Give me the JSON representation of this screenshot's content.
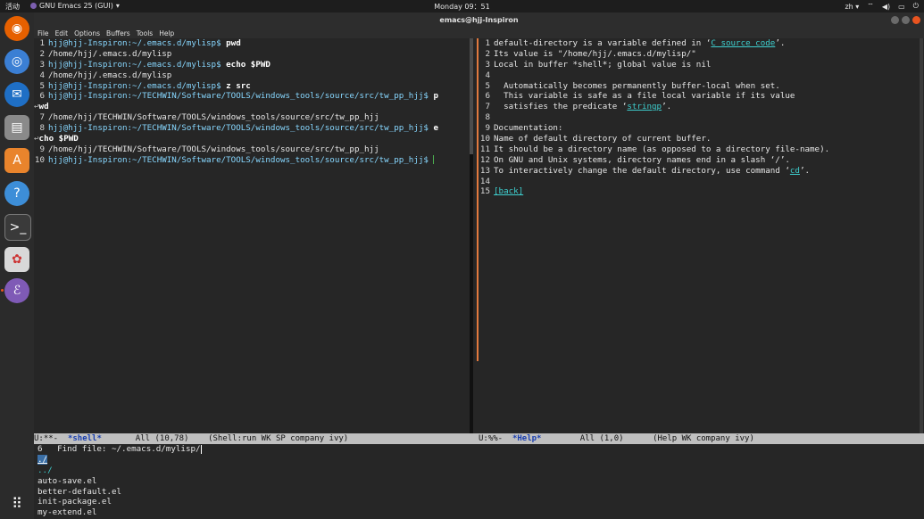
{
  "topbar": {
    "activities": "活动",
    "app_menu": "GNU Emacs 25 (GUI)",
    "clock": "Monday 09：51",
    "lang": "zh"
  },
  "window": {
    "title": "emacs@hjj-Inspiron",
    "menu": [
      "File",
      "Edit",
      "Options",
      "Buffers",
      "Tools",
      "Help"
    ]
  },
  "dock": {
    "apps": [
      "firefox-icon",
      "chromium-icon",
      "thunderbird-icon",
      "files-icon",
      "software-center-icon",
      "help-icon",
      "terminal-icon",
      "paint-icon",
      "emacs-icon"
    ],
    "show_apps": "show-apps-icon"
  },
  "shell": {
    "lines": [
      {
        "n": "1",
        "prompt": "hjj@hjj-Inspiron:~/.emacs.d/mylisp$",
        "cmd": " pwd"
      },
      {
        "n": "2",
        "text": "/home/hjj/.emacs.d/mylisp"
      },
      {
        "n": "3",
        "prompt": "hjj@hjj-Inspiron:~/.emacs.d/mylisp$",
        "cmd": " echo $PWD"
      },
      {
        "n": "4",
        "text": "/home/hjj/.emacs.d/mylisp"
      },
      {
        "n": "5",
        "prompt": "hjj@hjj-Inspiron:~/.emacs.d/mylisp$",
        "cmd": " z src"
      },
      {
        "n": "6",
        "prompt": "hjj@hjj-Inspiron:~/TECHWIN/Software/TOOLS/windows_tools/source/src/tw_pp_hjj$",
        "cmd": " p",
        "cont": "wd"
      },
      {
        "n": "7",
        "text": "/home/hjj/TECHWIN/Software/TOOLS/windows_tools/source/src/tw_pp_hjj"
      },
      {
        "n": "8",
        "prompt": "hjj@hjj-Inspiron:~/TECHWIN/Software/TOOLS/windows_tools/source/src/tw_pp_hjj$",
        "cmd": " e",
        "cont": "cho $PWD"
      },
      {
        "n": "9",
        "text": "/home/hjj/TECHWIN/Software/TOOLS/windows_tools/source/src/tw_pp_hjj"
      },
      {
        "n": "10",
        "prompt": "hjj@hjj-Inspiron:~/TECHWIN/Software/TOOLS/windows_tools/source/src/tw_pp_hjj$",
        "cmd": " "
      }
    ]
  },
  "help": {
    "line1_pre": "default-directory is a variable defined in ‘",
    "line1_link": "C source code",
    "line1_post": "’.",
    "line2": "Its value is \"/home/hjj/.emacs.d/mylisp/\"",
    "line3": "Local in buffer *shell*; global value is nil",
    "line5": "  Automatically becomes permanently buffer-local when set.",
    "line6": "  This variable is safe as a file local variable if its value",
    "line7_pre": "  satisfies the predicate ‘",
    "line7_link": "stringp",
    "line7_post": "’.",
    "line9": "Documentation:",
    "line10": "Name of default directory of current buffer.",
    "line11": "It should be a directory name (as opposed to a directory file-name).",
    "line12": "On GNU and Unix systems, directory names end in a slash ‘/’.",
    "line13_pre": "To interactively change the default directory, use command ‘",
    "line13_link": "cd",
    "line13_post": "’.",
    "line15_link": "[back]",
    "numbers": [
      "1",
      "2",
      "3",
      "4",
      "5",
      "6",
      "7",
      "8",
      "9",
      "10",
      "11",
      "12",
      "13",
      "14",
      "15"
    ]
  },
  "modeline": {
    "left_pre": "U:**-  ",
    "left_buf": "*shell*",
    "left_post": "       All (10,78)    (Shell:run WK SP company ivy)",
    "right_pre": "U:%%-  ",
    "right_buf": "*Help*",
    "right_post": "        All (1,0)      (Help WK company ivy)"
  },
  "minibuffer": {
    "count": "6",
    "prompt": "   Find file: ~/.emacs.d/mylisp/",
    "selected": "./",
    "items": [
      "../",
      "auto-save.el",
      "better-default.el",
      "init-package.el",
      "my-extend.el"
    ]
  }
}
